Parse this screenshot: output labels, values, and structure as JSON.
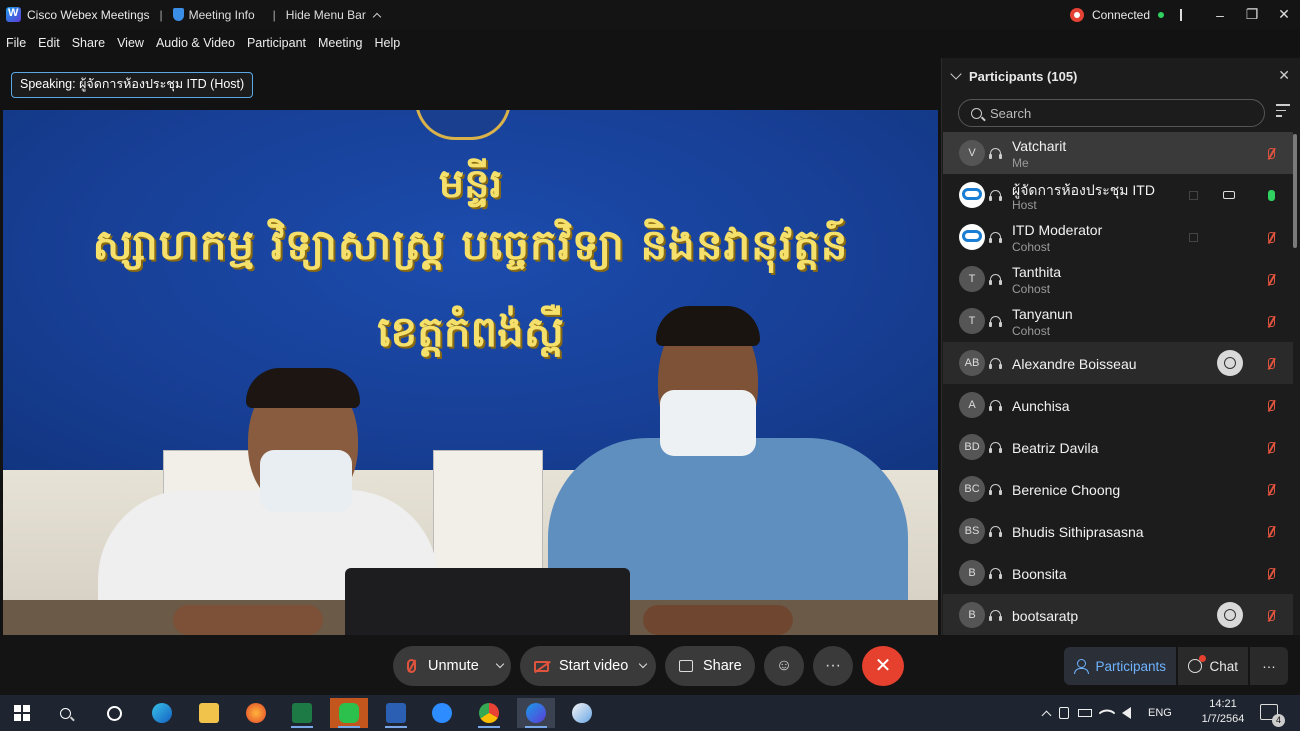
{
  "titlebar": {
    "app_name": "Cisco Webex Meetings",
    "sep1": "|",
    "meeting_info": "Meeting Info",
    "sep2": "|",
    "hide_menu_bar": "Hide Menu Bar",
    "status": "Connected",
    "minimize": "–",
    "restore": "❐",
    "close": "✕"
  },
  "menu": [
    "File",
    "Edit",
    "Share",
    "View",
    "Audio & Video",
    "Participant",
    "Meeting",
    "Help"
  ],
  "speaking": "Speaking: ผู้จัดการห้องประชุม ITD (Host)",
  "video_banner": {
    "line1": "មន្ទីរ",
    "line2": "ស្សាហកម្ម វិទ្យាសាស្ត្រ បច្ចេកវិទ្យា និងនវានុវត្តន៍",
    "line3": "ខេត្តកំពង់ស្ពឺ"
  },
  "participants_panel": {
    "title": "Participants (105)",
    "close": "✕",
    "search_placeholder": "Search",
    "rows": [
      {
        "initials": "V",
        "name": "Vatcharit",
        "role": "Me",
        "mic": "muted"
      },
      {
        "initials": "",
        "name": "ผู้จัดการห้องประชุม ITD",
        "role": "Host",
        "mic": "on"
      },
      {
        "initials": "",
        "name": "ITD Moderator",
        "role": "Cohost",
        "mic": "muted"
      },
      {
        "initials": "T",
        "name": "Tanthita",
        "role": "Cohost",
        "mic": "muted"
      },
      {
        "initials": "T",
        "name": "Tanyanun",
        "role": "Cohost",
        "mic": "muted"
      },
      {
        "initials": "AB",
        "name": "Alexandre Boisseau",
        "role": "",
        "mic": "muted"
      },
      {
        "initials": "A",
        "name": "Aunchisa",
        "role": "",
        "mic": "muted"
      },
      {
        "initials": "BD",
        "name": "Beatriz Davila",
        "role": "",
        "mic": "muted"
      },
      {
        "initials": "BC",
        "name": "Berenice Choong",
        "role": "",
        "mic": "muted"
      },
      {
        "initials": "BS",
        "name": "Bhudis Sithiprasasna",
        "role": "",
        "mic": "muted"
      },
      {
        "initials": "B",
        "name": "Boonsita",
        "role": "",
        "mic": "muted"
      },
      {
        "initials": "B",
        "name": "bootsaratp",
        "role": "",
        "mic": "muted"
      }
    ]
  },
  "controls": {
    "unmute": "Unmute",
    "start_video": "Start video",
    "share": "Share",
    "reactions": "☺",
    "more": "···",
    "end": "✕",
    "participants_tab": "Participants",
    "chat_tab": "Chat",
    "panel_more": "···"
  },
  "taskbar": {
    "lang": "ENG",
    "time": "14:21",
    "date": "1/7/2564",
    "notifications": "4"
  },
  "colors": {
    "accent_blue": "#6fb3ff",
    "muted_red": "#e0533d",
    "end_red": "#e5412e",
    "connected_green": "#2fd161"
  }
}
